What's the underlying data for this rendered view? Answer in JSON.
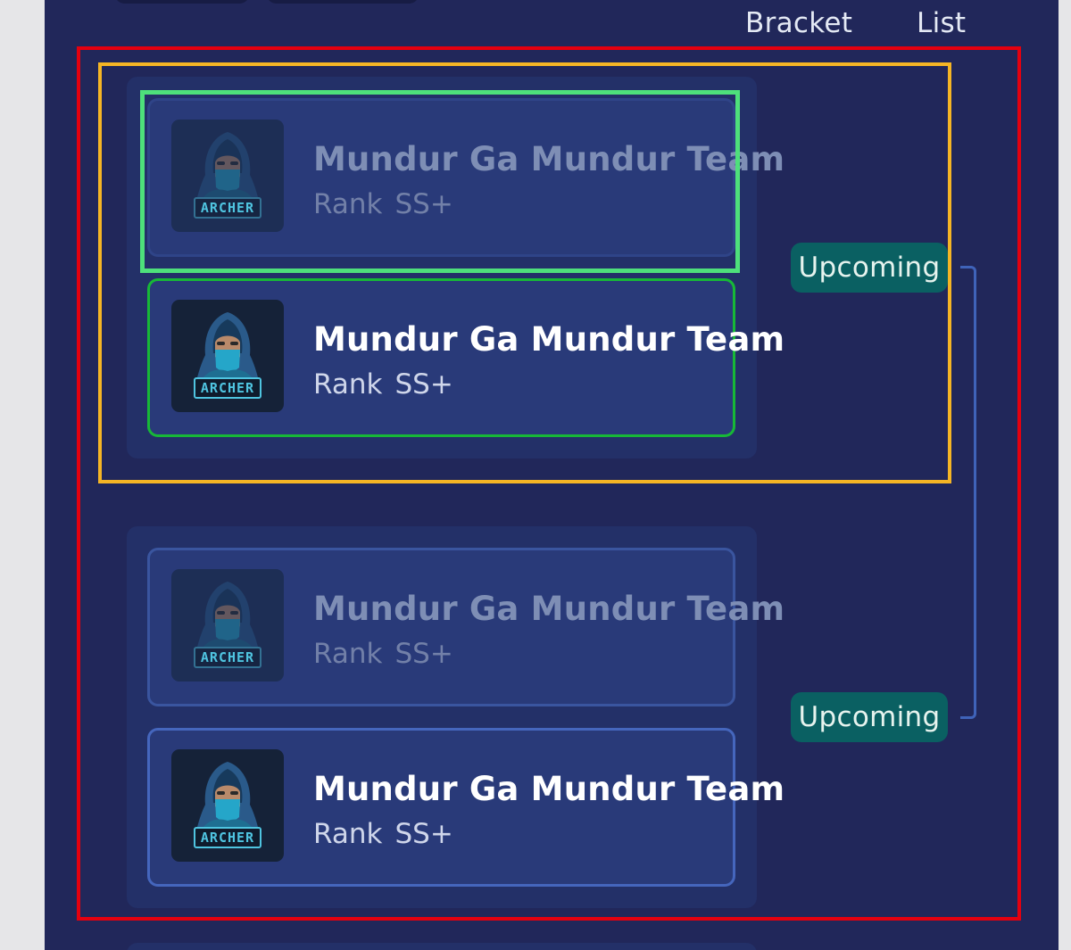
{
  "view_tabs": {
    "bracket_label": "Bracket",
    "list_label": "List"
  },
  "colors": {
    "page_bg": "#21275a",
    "match_bg": "#233068",
    "team_bg": "#293a79",
    "badge_bg": "#0a6062",
    "annotation_red": "#e5000f",
    "annotation_orange": "#f5b525",
    "annotation_light_green": "#4ee07b",
    "winner_border_green": "#17b837",
    "connector_blue": "#3f63b9"
  },
  "matches": [
    {
      "status": "Upcoming",
      "teams": [
        {
          "name": "Mundur Ga Mundur Team",
          "rank_label": "Rank",
          "rank_value": "SS+",
          "logo_text": "ARCHER",
          "icon": "archer-logo-icon"
        },
        {
          "name": "Mundur Ga Mundur Team",
          "rank_label": "Rank",
          "rank_value": "SS+",
          "logo_text": "ARCHER",
          "icon": "archer-logo-icon"
        }
      ]
    },
    {
      "status": "Upcoming",
      "teams": [
        {
          "name": "Mundur Ga Mundur Team",
          "rank_label": "Rank",
          "rank_value": "SS+",
          "logo_text": "ARCHER",
          "icon": "archer-logo-icon"
        },
        {
          "name": "Mundur Ga Mundur Team",
          "rank_label": "Rank",
          "rank_value": "SS+",
          "logo_text": "ARCHER",
          "icon": "archer-logo-icon"
        }
      ]
    }
  ]
}
